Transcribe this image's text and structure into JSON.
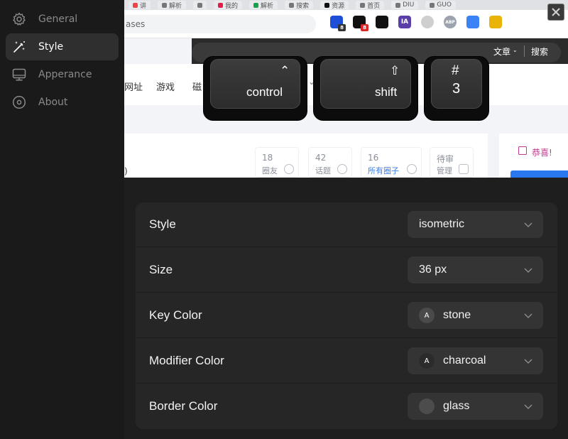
{
  "sidebar": {
    "items": [
      {
        "label": "General",
        "icon": "gear-icon"
      },
      {
        "label": "Style",
        "icon": "magic-wand-icon",
        "active": true
      },
      {
        "label": "Apperance",
        "icon": "monitor-icon"
      },
      {
        "label": "About",
        "icon": "info-circle-icon"
      }
    ]
  },
  "preview": {
    "tabs": [
      "讲",
      "解析",
      "",
      "我的",
      "解析",
      "",
      "搜索",
      "",
      "资源",
      "",
      "首页",
      "",
      "DIU",
      "",
      "GUO"
    ],
    "url_fragment": "ases",
    "extensions": [
      {
        "name": "extension-1",
        "badge": "8"
      },
      {
        "name": "extension-2",
        "badge": "8"
      },
      {
        "name": "extension-3",
        "badge": ""
      },
      {
        "name": "extension-ia",
        "text": "IA"
      },
      {
        "name": "extension-5",
        "badge": ""
      },
      {
        "name": "extension-abp",
        "text": "ABP"
      },
      {
        "name": "extension-translate",
        "badge": ""
      },
      {
        "name": "extension-8",
        "badge": ""
      }
    ],
    "header_links": {
      "articles": "文章",
      "search": "搜索"
    },
    "site_nav": [
      "网址",
      "游戏",
      "磁"
    ],
    "stats": [
      {
        "num": "18",
        "label": "圈友"
      },
      {
        "num": "42",
        "label": "话题"
      },
      {
        "num": "16",
        "label": "所有圈子"
      },
      {
        "num": "待审",
        "label": "管理"
      }
    ],
    "congrats": "恭喜!",
    "paren": ")"
  },
  "keys": [
    {
      "symbol": "⌃",
      "label": "control"
    },
    {
      "symbol": "⇧",
      "label": "shift"
    },
    {
      "symbol": "#",
      "label": "3"
    }
  ],
  "settings": {
    "rows": [
      {
        "label": "Style",
        "value": "isometric"
      },
      {
        "label": "Size",
        "value": "36 px"
      },
      {
        "label": "Key Color",
        "value": "stone",
        "swatch": "A",
        "swatch_color": "#4a4a4a"
      },
      {
        "label": "Modifier Color",
        "value": "charcoal",
        "swatch": "A",
        "swatch_color": "#2b2b2b"
      },
      {
        "label": "Border Color",
        "value": "glass",
        "swatch": "",
        "swatch_color": "#4c4c4c"
      }
    ]
  },
  "colors": {
    "accent_blue": "#3d7ee8",
    "panel_bg": "#262626",
    "sidebar_bg": "#1a1a1a"
  }
}
